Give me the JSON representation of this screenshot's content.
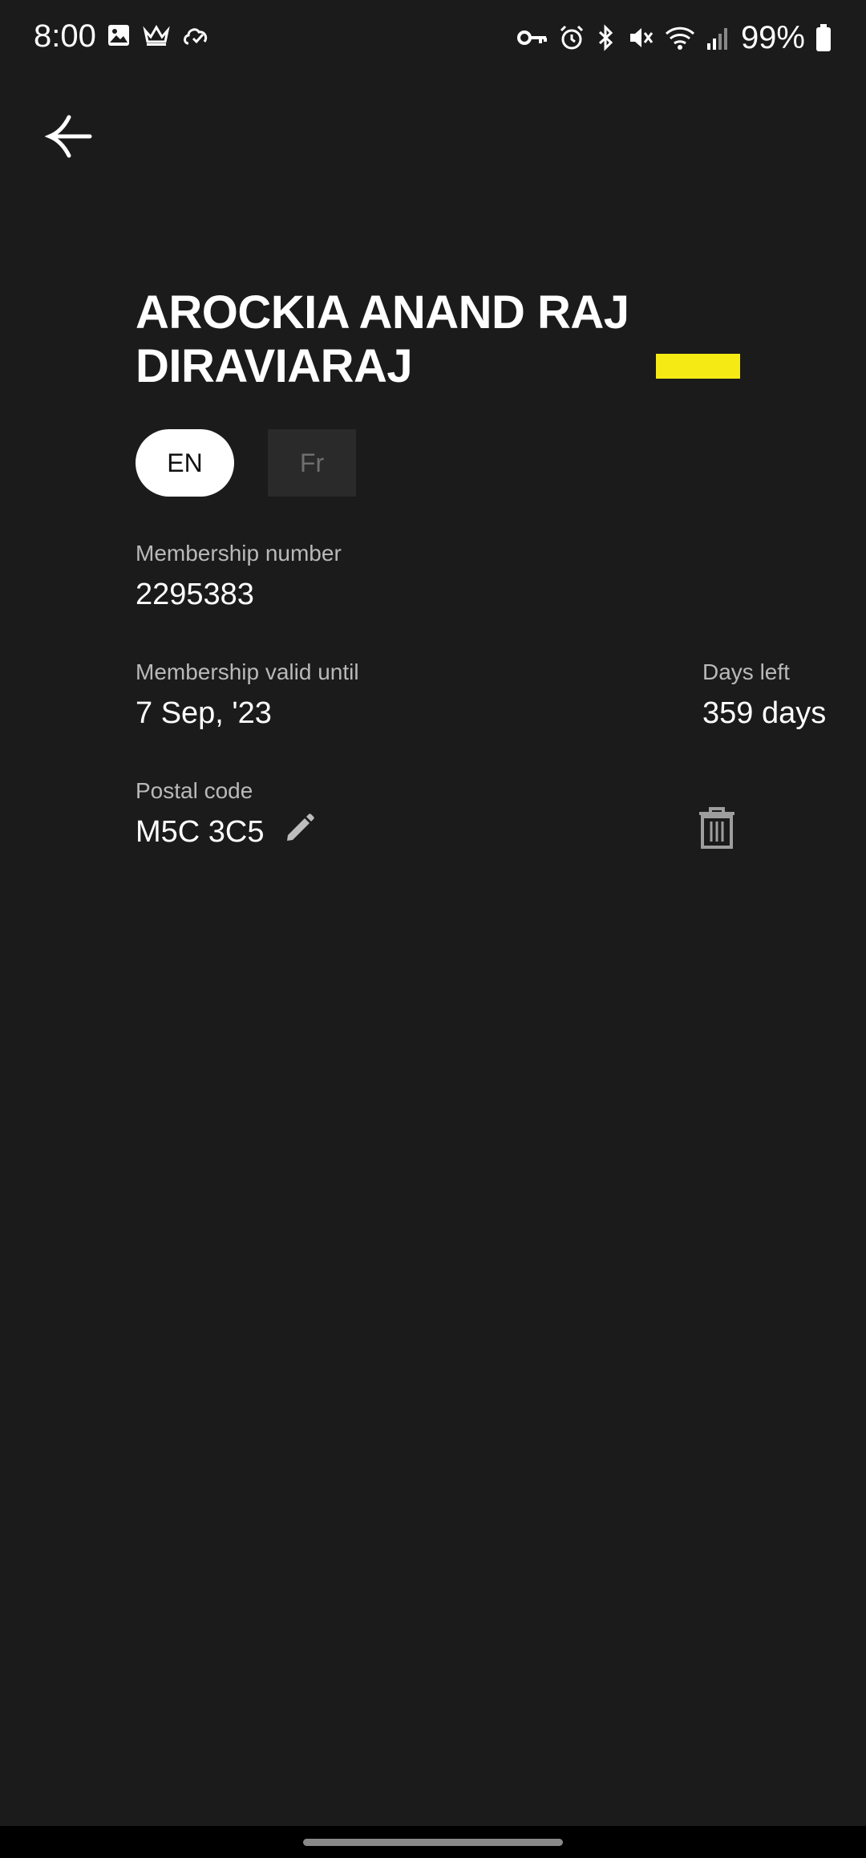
{
  "status_bar": {
    "time": "8:00",
    "battery": "99%",
    "left_icons": [
      "gallery-icon",
      "crown-icon",
      "cloud-check-icon"
    ],
    "right_icons": [
      "vpn-key-icon",
      "alarm-icon",
      "bluetooth-icon",
      "mute-icon",
      "wifi-icon",
      "signal-icon",
      "battery-icon"
    ]
  },
  "header": {
    "back_icon": "back-arrow-icon"
  },
  "member": {
    "name_line1": "AROCKIA ANAND RAJ",
    "name_line2": "DIRAVIARAJ",
    "accent_color": "#f5ea14"
  },
  "language": {
    "options": [
      {
        "label": "EN",
        "selected": true
      },
      {
        "label": "Fr",
        "selected": false
      }
    ]
  },
  "membership": {
    "number_label": "Membership number",
    "number_value": "2295383",
    "valid_label": "Membership valid until",
    "valid_value": "7 Sep, '23",
    "days_left_label": "Days left",
    "days_left_value": "359 days",
    "postal_label": "Postal code",
    "postal_value": "M5C 3C5",
    "edit_icon": "pencil-icon",
    "delete_icon": "trash-icon"
  },
  "colors": {
    "background": "#1b1b1b",
    "text_primary": "#ffffff",
    "text_secondary": "#b9b9b9"
  }
}
